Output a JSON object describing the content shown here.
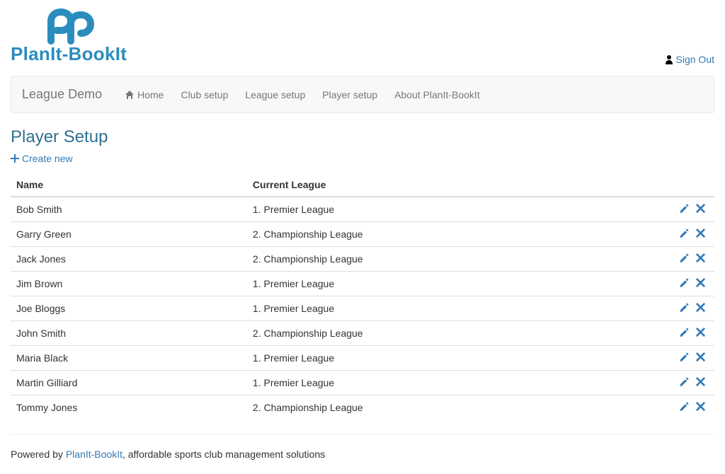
{
  "header": {
    "brand": "PlanIt-BookIt",
    "signout": "Sign Out"
  },
  "navbar": {
    "brand": "League Demo",
    "items": [
      {
        "label": "Home",
        "icon": "home"
      },
      {
        "label": "Club setup"
      },
      {
        "label": "League setup"
      },
      {
        "label": "Player setup"
      },
      {
        "label": "About PlanIt-BookIt"
      }
    ]
  },
  "page": {
    "title": "Player Setup",
    "create": "Create new"
  },
  "table": {
    "headers": {
      "name": "Name",
      "league": "Current League"
    },
    "rows": [
      {
        "name": "Bob Smith",
        "league": "1. Premier League"
      },
      {
        "name": "Garry Green",
        "league": "2. Championship League"
      },
      {
        "name": "Jack Jones",
        "league": "2. Championship League"
      },
      {
        "name": "Jim Brown",
        "league": "1. Premier League"
      },
      {
        "name": "Joe Bloggs",
        "league": "1. Premier League"
      },
      {
        "name": "John Smith",
        "league": "2. Championship League"
      },
      {
        "name": "Maria Black",
        "league": "1. Premier League"
      },
      {
        "name": "Martin Gilliard",
        "league": "1. Premier League"
      },
      {
        "name": "Tommy Jones",
        "league": "2. Championship League"
      }
    ]
  },
  "footer": {
    "prefix": "Powered by ",
    "link": "PlanIt-BookIt",
    "suffix": ", affordable sports club management solutions"
  }
}
